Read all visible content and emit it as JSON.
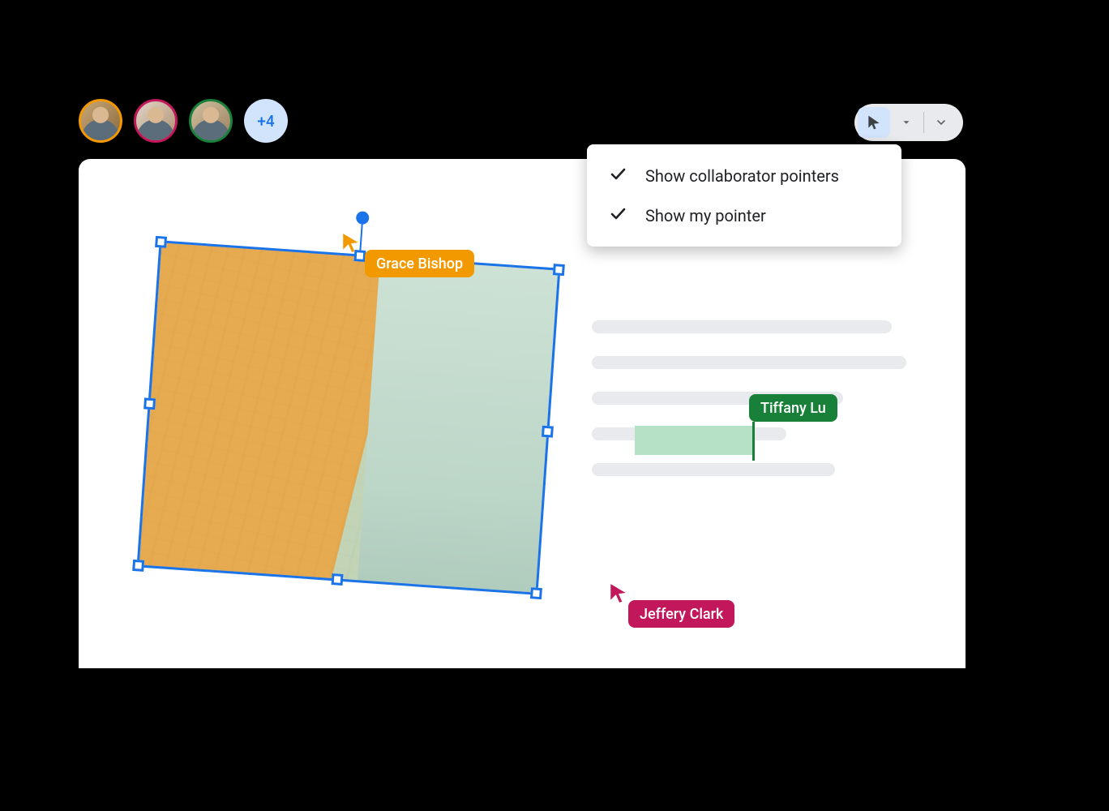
{
  "toolbar": {
    "menu": {
      "items": [
        {
          "label": "Show collaborator pointers",
          "checked": true
        },
        {
          "label": "Show my pointer",
          "checked": true
        }
      ]
    }
  },
  "collaborators": {
    "overflow_count_label": "+4",
    "pointers": {
      "grace": {
        "name": "Grace Bishop",
        "color": "#f29900"
      },
      "jeffery": {
        "name": "Jeffery Clark",
        "color": "#c2185b"
      },
      "tiffany": {
        "name": "Tiffany Lu",
        "color": "#188038"
      }
    },
    "avatars": [
      {
        "ring_color": "#f29900"
      },
      {
        "ring_color": "#c2185b"
      },
      {
        "ring_color": "#188038"
      }
    ]
  }
}
